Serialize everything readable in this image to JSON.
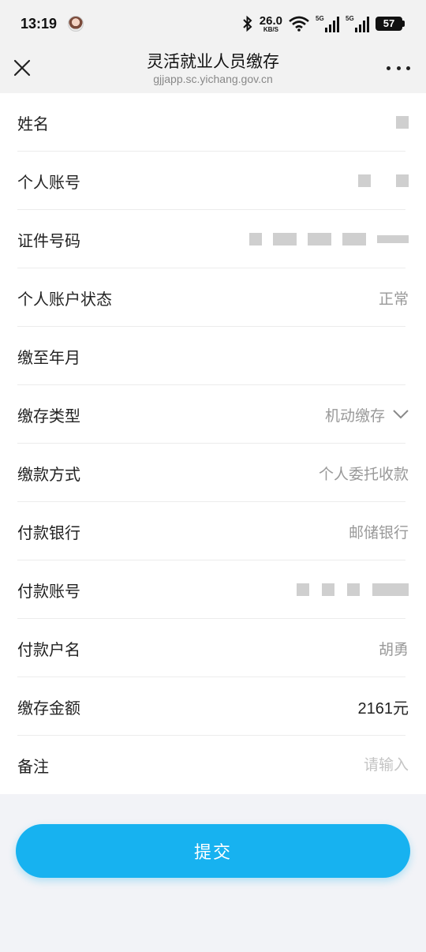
{
  "status_bar": {
    "time": "13:19",
    "net_speed": "26.0",
    "net_speed_unit": "KB/S",
    "signal1_label": "5G",
    "signal2_label": "5G",
    "battery": "57"
  },
  "nav": {
    "title": "灵活就业人员缴存",
    "url": "gjjapp.sc.yichang.gov.cn"
  },
  "form": {
    "name_label": "姓名",
    "account_label": "个人账号",
    "id_label": "证件号码",
    "status_label": "个人账户状态",
    "status_value": "正常",
    "paid_until_label": "缴至年月",
    "type_label": "缴存类型",
    "type_value": "机动缴存",
    "method_label": "缴款方式",
    "method_value": "个人委托收款",
    "bank_label": "付款银行",
    "bank_value": "邮储银行",
    "pay_account_label": "付款账号",
    "payer_label": "付款户名",
    "payer_value": "胡勇",
    "amount_label": "缴存金额",
    "amount_value": "2161元",
    "remark_label": "备注",
    "remark_placeholder": "请输入"
  },
  "submit_label": "提交",
  "colors": {
    "accent": "#17b2f0",
    "background": "#f2f3f7"
  }
}
